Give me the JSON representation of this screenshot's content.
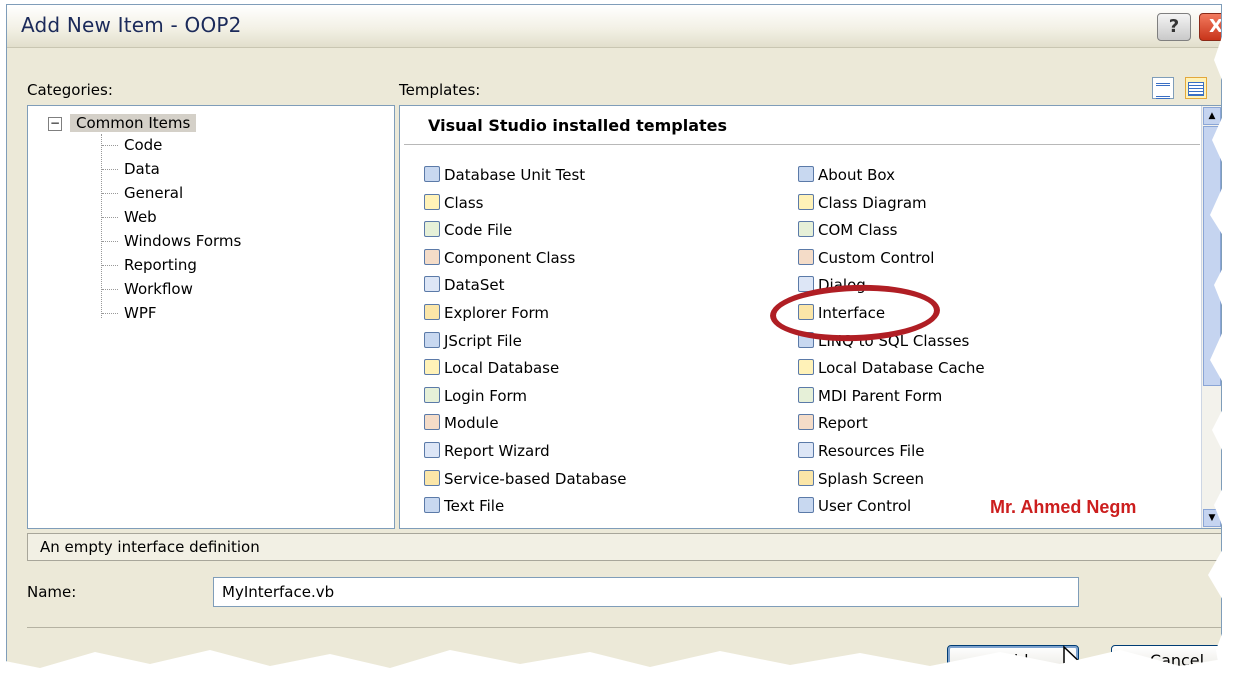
{
  "window": {
    "title": "Add New Item - OOP2",
    "help_label": "?",
    "close_label": "X"
  },
  "categories": {
    "label": "Categories:",
    "root": "Common Items",
    "items": [
      "Code",
      "Data",
      "General",
      "Web",
      "Windows Forms",
      "Reporting",
      "Workflow",
      "WPF"
    ]
  },
  "templates": {
    "label": "Templates:",
    "header": "Visual Studio installed templates",
    "left_column": [
      {
        "label": "Database Unit Test",
        "icon": "database-unit-test-icon"
      },
      {
        "label": "Class",
        "icon": "class-icon"
      },
      {
        "label": "Code File",
        "icon": "code-file-icon"
      },
      {
        "label": "Component Class",
        "icon": "component-class-icon"
      },
      {
        "label": "DataSet",
        "icon": "dataset-icon"
      },
      {
        "label": "Explorer Form",
        "icon": "explorer-form-icon"
      },
      {
        "label": "JScript File",
        "icon": "jscript-file-icon"
      },
      {
        "label": "Local Database",
        "icon": "local-database-icon"
      },
      {
        "label": "Login Form",
        "icon": "login-form-icon"
      },
      {
        "label": "Module",
        "icon": "module-icon"
      },
      {
        "label": "Report Wizard",
        "icon": "report-wizard-icon"
      },
      {
        "label": "Service-based Database",
        "icon": "service-database-icon"
      },
      {
        "label": "Text File",
        "icon": "text-file-icon"
      }
    ],
    "right_column": [
      {
        "label": "About Box",
        "icon": "about-box-icon"
      },
      {
        "label": "Class Diagram",
        "icon": "class-diagram-icon"
      },
      {
        "label": "COM Class",
        "icon": "com-class-icon"
      },
      {
        "label": "Custom Control",
        "icon": "custom-control-icon"
      },
      {
        "label": "Dialog",
        "icon": "dialog-icon"
      },
      {
        "label": "Interface",
        "icon": "interface-icon"
      },
      {
        "label": "LINQ to SQL Classes",
        "icon": "linq-icon"
      },
      {
        "label": "Local Database Cache",
        "icon": "database-cache-icon"
      },
      {
        "label": "MDI Parent Form",
        "icon": "mdi-form-icon"
      },
      {
        "label": "Report",
        "icon": "report-icon"
      },
      {
        "label": "Resources File",
        "icon": "resources-file-icon"
      },
      {
        "label": "Splash Screen",
        "icon": "splash-screen-icon"
      },
      {
        "label": "User Control",
        "icon": "user-control-icon"
      }
    ],
    "watermark": "Mr. Ahmed Negm"
  },
  "description": "An empty interface definition",
  "name_field": {
    "label": "Name:",
    "value": "MyInterface.vb"
  },
  "buttons": {
    "add": "Add",
    "cancel": "Cancel"
  },
  "colors": {
    "dialog_bg": "#ece9d8",
    "highlight_ring": "#b01e24",
    "watermark": "#cc1e1e"
  }
}
